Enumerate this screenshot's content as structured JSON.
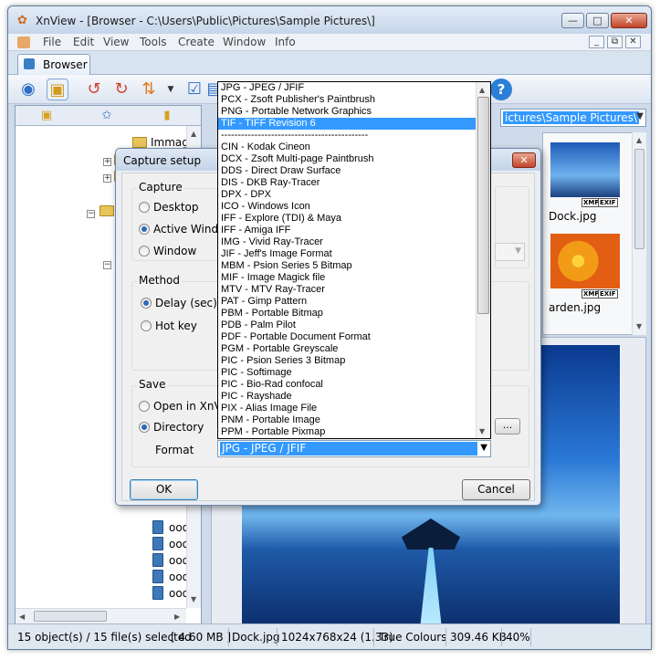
{
  "window": {
    "title": "XnView - [Browser - C:\\Users\\Public\\Pictures\\Sample Pictures\\]",
    "minimize": "—",
    "maximize": "□",
    "close": "✕"
  },
  "menu": {
    "items": [
      "File",
      "Edit",
      "View",
      "Tools",
      "Create",
      "Window",
      "Info"
    ],
    "mdi_min": "_",
    "mdi_restore": "⧉",
    "mdi_close": "✕"
  },
  "tabs": {
    "browser": "Browser"
  },
  "tree": {
    "top_folder": "Immag",
    "partial_label": "w",
    "file_label": "ooo"
  },
  "path_combo": {
    "value": "ictures\\Sample Pictures\\"
  },
  "thumbnails": [
    {
      "label": "Dock.jpg",
      "badges": [
        "XMP",
        "EXIF"
      ]
    },
    {
      "label": "arden.jpg",
      "badges": [
        "XMP",
        "EXIF"
      ]
    }
  ],
  "status": {
    "objects": "15 object(s) / 15 file(s) selected",
    "size": "[ 4.60 MB ]",
    "file": "Dock.jpg",
    "dims": "1024x768x24 (1.33)",
    "colors": "True Colours",
    "filesize": "309.46 KB",
    "zoom": "40%"
  },
  "dialog": {
    "title": "Capture setup",
    "close": "✕",
    "capture": {
      "label": "Capture",
      "options": [
        "Desktop",
        "Active Window",
        "Window"
      ],
      "selected": 1
    },
    "method": {
      "label": "Method",
      "options": [
        "Delay (sec)",
        "Hot key"
      ],
      "selected": 0
    },
    "save": {
      "label": "Save",
      "options": [
        "Open in XnView",
        "Directory"
      ],
      "selected": 1,
      "format_label": "Format",
      "format_value": "JPG - JPEG / JFIF",
      "browse": "..."
    },
    "ok": "OK",
    "cancel": "Cancel"
  },
  "dropdown": {
    "selected_index": 3,
    "items": [
      "JPG - JPEG / JFIF",
      "PCX - Zsoft Publisher's Paintbrush",
      "PNG - Portable Network Graphics",
      "TIF - TIFF Revision 6",
      "--------------------------------------------",
      "CIN - Kodak Cineon",
      "DCX - Zsoft Multi-page Paintbrush",
      "DDS - Direct Draw Surface",
      "DIS - DKB Ray-Tracer",
      "DPX - DPX",
      "ICO - Windows Icon",
      "IFF - Explore (TDI) & Maya",
      "IFF - Amiga IFF",
      "IMG - Vivid Ray-Tracer",
      "JIF - Jeff's Image Format",
      "MBM - Psion Series 5 Bitmap",
      "MIF - Image Magick file",
      "MTV - MTV Ray-Tracer",
      "PAT - Gimp Pattern",
      "PBM - Portable Bitmap",
      "PDB - Palm Pilot",
      "PDF - Portable Document Format",
      "PGM - Portable Greyscale",
      "PIC - Psion Series 3 Bitmap",
      "PIC - Softimage",
      "PIC - Bio-Rad confocal",
      "PIC - Rayshade",
      "PIX - Alias Image File",
      "PNM - Portable Image",
      "PPM - Portable Pixmap"
    ]
  },
  "colors": {
    "selection": "#3399ff",
    "titlebar": "#c6d6ea",
    "close": "#c2442a"
  }
}
